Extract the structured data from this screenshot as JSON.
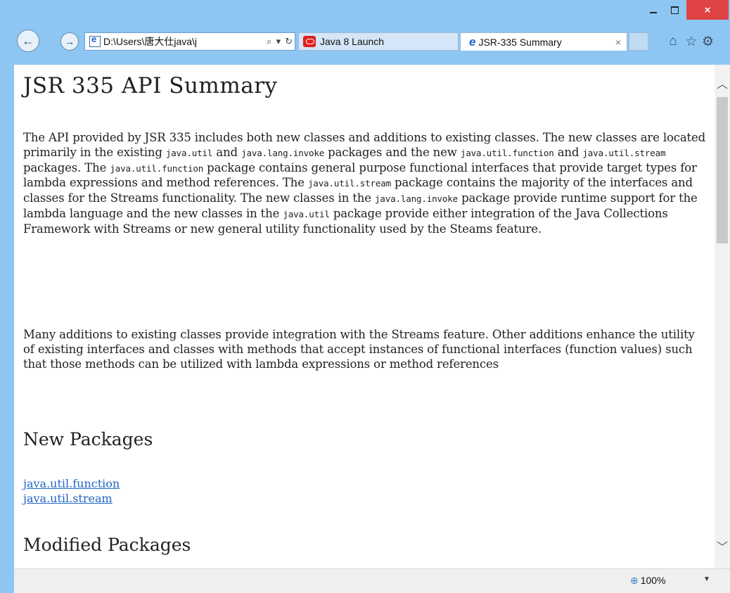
{
  "window": {
    "minimize": "–",
    "maximize": "□",
    "close": "×"
  },
  "toolbar": {
    "back_glyph": "←",
    "forward_glyph": "→",
    "address_value": "D:\\Users\\唐大仕java\\j",
    "search_glyph": "⌕",
    "dropdown_glyph": "▾",
    "refresh_glyph": "↻",
    "home_icon": "home-icon",
    "favorites_icon": "star-icon",
    "tools_icon": "gear-icon"
  },
  "tabs": [
    {
      "label": "Java 8 Launch",
      "icon": "java-icon",
      "active": false
    },
    {
      "label": "JSR-335 Summary",
      "icon": "ie-icon",
      "active": true,
      "close": "×"
    }
  ],
  "page": {
    "title": "JSR 335 API Summary",
    "para1": [
      {
        "t": "The API provided by JSR 335 includes both new classes and additions to existing classes. The new classes are located primarily in the existing "
      },
      {
        "c": "java.util"
      },
      {
        "t": " and "
      },
      {
        "c": "java.lang.invoke"
      },
      {
        "t": " packages and the new "
      },
      {
        "c": "java.util.function"
      },
      {
        "t": " and "
      },
      {
        "c": "java.util.stream"
      },
      {
        "t": " packages. The "
      },
      {
        "c": "java.util.function"
      },
      {
        "t": " package contains general purpose functional interfaces that provide target types for lambda expressions and method references. The "
      },
      {
        "c": "java.util.stream"
      },
      {
        "t": " package contains the majority of the interfaces and classes for the Streams functionality. The new classes in the "
      },
      {
        "c": "java.lang.invoke"
      },
      {
        "t": " package provide runtime support for the lambda language and the new classes in the "
      },
      {
        "c": "java.util"
      },
      {
        "t": " package provide either integration of the Java Collections Framework with Streams or new general utility functionality used by the Steams feature."
      }
    ],
    "para2": "Many additions to existing classes provide integration with the Streams feature. Other additions enhance the utility of existing interfaces and classes with methods that accept instances of functional interfaces (function values) such that those methods can be utilized with lambda expressions or method references",
    "new_packages_heading": "New Packages",
    "new_packages": [
      "java.util.function",
      "java.util.stream"
    ],
    "modified_packages_heading": "Modified Packages"
  },
  "statusbar": {
    "zoom": "100%",
    "zoom_icon": "zoom-icon",
    "caret": "▼"
  }
}
